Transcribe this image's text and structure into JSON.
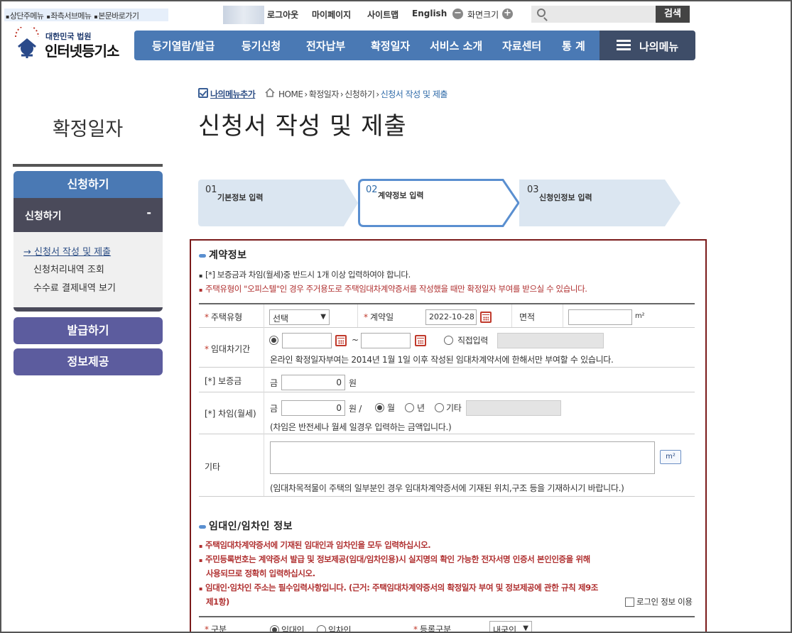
{
  "skip_links": [
    "상단주메뉴",
    "좌측서브메뉴",
    "본문바로가기"
  ],
  "util": {
    "logout": "로그아웃",
    "mypage": "마이페이지",
    "sitemap": "사이트맵",
    "english": "English",
    "zoom_label": "화면크기",
    "zoom_minus": "−",
    "zoom_plus": "+",
    "search_button": "검색"
  },
  "logo": {
    "small": "대한민국 법원",
    "big": "인터넷등기소"
  },
  "gnb": [
    "등기열람/발급",
    "등기신청",
    "전자납부",
    "확정일자",
    "서비스 소개",
    "자료센터",
    "통 계"
  ],
  "my_menu": "나의메뉴",
  "lnb": {
    "title": "확정일자",
    "apply": "신청하기",
    "sub_title": "신청하기",
    "sub_toggle": "-",
    "links": [
      "→ 신청서 작성 및 제출",
      "신청처리내역 조회",
      "수수료 결제내역 보기"
    ],
    "issue": "발급하기",
    "info": "정보제공"
  },
  "breadcrumb": {
    "add_menu": "나의메뉴추가",
    "items": [
      "HOME",
      "확정일자",
      "신청하기",
      "신청서 작성 및 제출"
    ]
  },
  "page_title": "신청서 작성 및 제출",
  "steps": [
    {
      "num": "01",
      "label": "기본정보 입력",
      "active": false
    },
    {
      "num": "02",
      "label": "계약정보 입력",
      "active": true
    },
    {
      "num": "03",
      "label": "신청인정보 입력",
      "active": false
    }
  ],
  "contract": {
    "title": "계약정보",
    "notes": [
      "[*] 보증금과 차임(월세)중 반드시 1개 이상 입력하여야 합니다.",
      "주택유형이 \"오피스텔\"인 경우 주거용도로 주택임대차계약증서를 작성했을 때만 확정일자 부여를 받으실 수 있습니다."
    ],
    "req_mark": "*",
    "housing_type_label": "주택유형",
    "housing_type_value": "선택",
    "contract_date_label": "계약일",
    "contract_date_value": "2022-10-28",
    "area_label": "면적",
    "area_unit": "m²",
    "lease_period_label": "임대차기간",
    "tilde": "~",
    "direct_input": "직접입력",
    "lease_note": "온라인 확정일자부여는 2014년 1월 1일 이후 작성된 임대차계약서에 한해서만 부여할 수 있습니다.",
    "deposit_label": "[*] 보증금",
    "geum": "금",
    "deposit_value": "0",
    "won": "원",
    "rent_label": "[*] 차임(월세)",
    "rent_value": "0",
    "rent_won_slash": "원  /",
    "monthly": "월",
    "yearly": "년",
    "etc_option": "기타",
    "rent_note": "(차임은 반전세나 월세 일경우 입력하는 금액입니다.)",
    "etc_label": "기타",
    "m2_button": "m²",
    "etc_note": "(임대차목적물이 주택의 일부분인 경우 임대차계약증서에 기재된 위치,구조 등을 기재하시기 바랍니다.)"
  },
  "parties": {
    "title": "임대인/임차인 정보",
    "notes": [
      "주택임대차계약증서에 기재된 임대인과 임차인을 모두 입력하십시오.",
      "주민등록번호는 계약증서 발급 및 정보제공(임대/임차인용)시 실지명의 확인 가능한 전자서명 인증서 본인인증을 위해",
      "사용되므로 정확히 입력하십시오.",
      "임대인·임차인 주소는 필수입력사항입니다. (근거: 주택임대차계약증서의 확정일자 부여 및 정보제공에 관한 규칙 제9조",
      "제1항)"
    ],
    "login_info": "로그인 정보 이용",
    "division_label": "구분",
    "lessor": "임대인",
    "lessee": "임차인",
    "reg_type_label": "등록구분",
    "reg_type_value": "내국인"
  },
  "colors": {
    "nav_blue": "#4a79b4",
    "nav_dark": "#3e4d68",
    "form_border": "#7a1a1a",
    "note_red": "#b03030"
  }
}
